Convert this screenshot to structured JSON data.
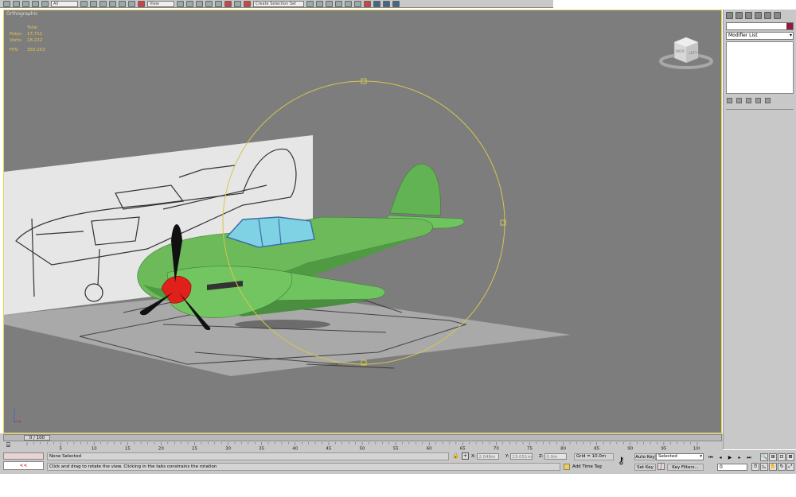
{
  "viewport": {
    "label": "Orthographic",
    "stats": [
      {
        "key": "",
        "value": "Total"
      },
      {
        "key": "Polys:",
        "value": "17,711"
      },
      {
        "key": "Verts:",
        "value": "18,222"
      },
      {
        "key": "FPS:",
        "value": "350.253"
      }
    ],
    "viewcube": {
      "back": "BACK",
      "left": "LEFT"
    },
    "axis": {
      "z": "z",
      "x": "x"
    }
  },
  "toolbar": {
    "filter_value": "All",
    "ref_coord": "View",
    "selection_set": "Create Selection Set"
  },
  "command_panel": {
    "modifier_list": "Modifier List"
  },
  "timeline": {
    "frame_indicator": "0 / 100",
    "ruler_labels": [
      "5",
      "10",
      "15",
      "20",
      "25",
      "30",
      "35",
      "40",
      "45",
      "50",
      "55",
      "60",
      "65",
      "70",
      "75",
      "80",
      "85",
      "90",
      "95",
      "100"
    ]
  },
  "status": {
    "listener_button": "<<",
    "selection_text": "None Selected",
    "prompt_text": "Click and drag to rotate the view.  Clicking in the tabs constrains the rotation",
    "x_label": "X:",
    "x_value": "2.048m",
    "y_label": "Y:",
    "y_value": "13.051m",
    "z_label": "Z:",
    "z_value": "0.0m",
    "grid": "Grid = 10.0m",
    "add_time_tag": "Add Time Tag",
    "auto_key": "Auto Key",
    "set_key": "Set Key",
    "key_mode": "Selected",
    "key_filters": "Key Filters...",
    "current_frame": "0"
  },
  "colors": {
    "viewport_bg": "#7d7d7d",
    "active_border": "#e5d84a",
    "plane_green": "#6cba5a",
    "spinner_red": "#e0201a",
    "canopy": "#7fd2e4",
    "object_color": "#8a1e3c"
  }
}
